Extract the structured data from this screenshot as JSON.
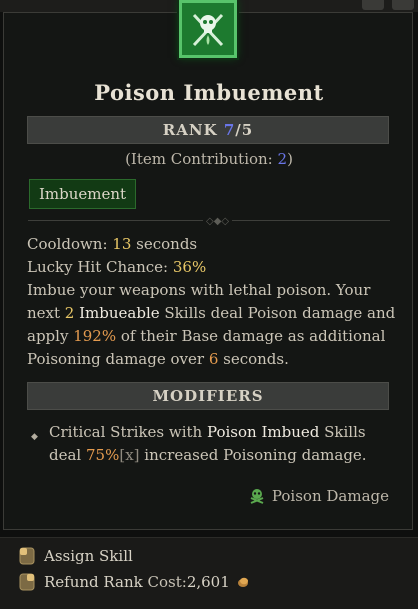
{
  "skill": {
    "title": "Poison Imbuement",
    "rank_label": "RANK",
    "rank_current": "7",
    "rank_max": "/5",
    "contribution_prefix": "(Item Contribution: ",
    "contribution_value": "2",
    "contribution_suffix": ")",
    "tag": "Imbuement"
  },
  "stats": {
    "cooldown_label": "Cooldown: ",
    "cooldown_value": "13",
    "cooldown_unit": " seconds",
    "lucky_label": "Lucky Hit Chance: ",
    "lucky_value": "36%"
  },
  "description": {
    "p1": "Imbue your weapons with lethal poison. Your next ",
    "count": "2",
    "p2": " ",
    "keyword": "Imbueable",
    "p3": " Skills deal Poison damage and apply ",
    "percent": "192%",
    "p4": " of their Base damage as additional Poisoning damage over ",
    "seconds": "6",
    "p5": " seconds."
  },
  "modifiers": {
    "heading": "MODIFIERS",
    "item": {
      "t1": "Critical Strikes with ",
      "keyword": "Poison Imbued",
      "t2": " Skills deal ",
      "value": "75%",
      "x": "[x]",
      "t3": " increased Poisoning damage."
    }
  },
  "damage_type": "Poison Damage",
  "footer": {
    "assign": "Assign Skill",
    "refund": "Refund Rank",
    "cost_label": "Cost: ",
    "cost_value": "2,601"
  },
  "colors": {
    "accent_blue": "#6a76e8",
    "highlight_yellow": "#e9c867",
    "highlight_orange": "#e49b4f",
    "icon_green": "#1d7a2f"
  },
  "icons": [
    "skull-crossed-daggers-icon",
    "poison-skull-icon",
    "mouse-left-icon",
    "mouse-right-icon",
    "gold-coin-icon"
  ]
}
